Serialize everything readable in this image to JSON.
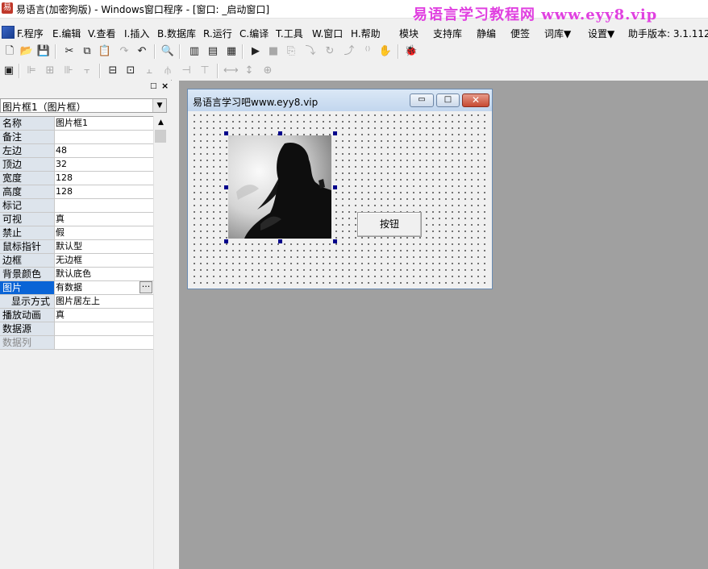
{
  "window": {
    "title": "易语言(加密狗版) - Windows窗口程序 - [窗口: _启动窗口]",
    "app_icon": "易"
  },
  "watermark": "易语言学习教程网 www.eyy8.vip",
  "menu": {
    "items": [
      "F.程序",
      "E.编辑",
      "V.查看",
      "I.插入",
      "B.数据库",
      "R.运行",
      "C.编译",
      "T.工具",
      "W.窗口",
      "H.帮助",
      "模块",
      "支持库",
      "静编",
      "便签",
      "词库▼",
      "设置▼",
      "助手版本: 3.1.112"
    ]
  },
  "toolbar1": {
    "buttons": [
      "new-file-icon",
      "open-file-icon",
      "save-icon",
      "cut-icon",
      "copy-icon",
      "paste-icon",
      "redo-icon",
      "undo-icon",
      "find-icon",
      "layout-1-icon",
      "layout-2-icon",
      "layout-3-icon",
      "run-icon",
      "stop-icon",
      "step-icon",
      "step-into-icon",
      "step-over-icon",
      "step-out-icon",
      "hand-icon",
      "debug-bug-icon"
    ]
  },
  "toolbar2": {
    "buttons": [
      "tab-order-icon",
      "align-left-icon",
      "align-center-icon",
      "align-right-icon",
      "align-top-icon",
      "align-middle-icon",
      "align-bottom-icon",
      "same-width-icon",
      "same-height-icon",
      "same-size-icon",
      "center-horizontal-icon",
      "center-vertical-icon",
      "space-horizontal-icon",
      "space-vertical-icon"
    ]
  },
  "properties": {
    "panel_pin": "□",
    "panel_close": "×",
    "object_select": "图片框1（图片框）",
    "rows": [
      {
        "name": "名称",
        "value": "图片框1"
      },
      {
        "name": "备注",
        "value": ""
      },
      {
        "name": "左边",
        "value": "48"
      },
      {
        "name": "顶边",
        "value": "32"
      },
      {
        "name": "宽度",
        "value": "128"
      },
      {
        "name": "高度",
        "value": "128"
      },
      {
        "name": "标记",
        "value": ""
      },
      {
        "name": "可视",
        "value": "真"
      },
      {
        "name": "禁止",
        "value": "假"
      },
      {
        "name": "鼠标指针",
        "value": "默认型"
      },
      {
        "name": "边框",
        "value": "无边框"
      },
      {
        "name": "背景颜色",
        "value": "默认底色"
      },
      {
        "name": "图片",
        "value": "有数据",
        "button": "···"
      },
      {
        "name": "显示方式",
        "value": "图片居左上"
      },
      {
        "name": "播放动画",
        "value": "真"
      },
      {
        "name": "数据源",
        "value": ""
      },
      {
        "name": "数据列",
        "value": ""
      }
    ]
  },
  "form": {
    "title": "易语言学习吧www.eyy8.vip",
    "button_label": "按钮",
    "min_symbol": "▭",
    "max_symbol": "□",
    "close_symbol": "✕"
  },
  "colors": {
    "selection": "#0a64d6",
    "design_background": "#a0a0a0",
    "watermark": "#e040e0",
    "handle": "#00008b"
  }
}
